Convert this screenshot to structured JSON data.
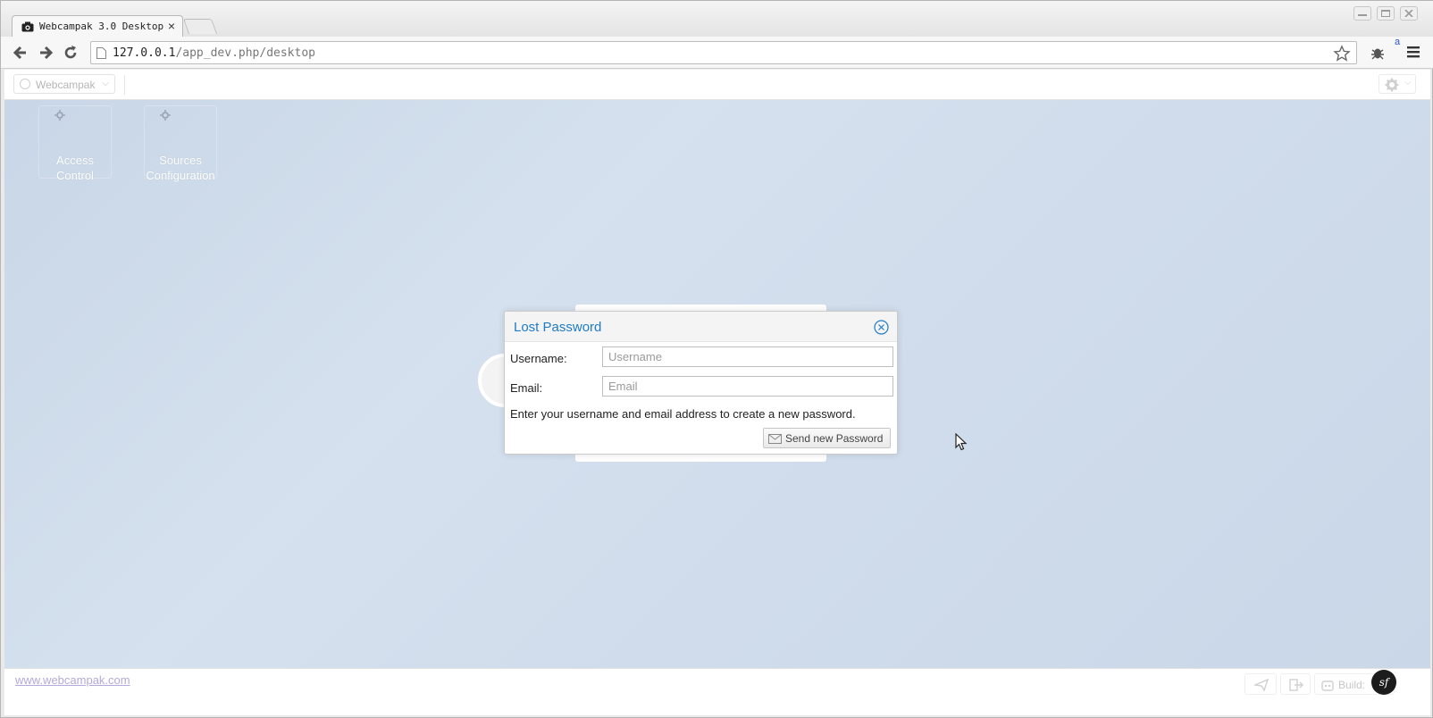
{
  "browser": {
    "tab_title": "Webcampak 3.0 Desktop",
    "tab_close": "×",
    "url_host": "127.0.0.1",
    "url_path": "/app_dev.php/desktop",
    "extension_badge": "a"
  },
  "appbar": {
    "app_name": "Webcampak",
    "app_menu_chevron": "⌵"
  },
  "desktop": {
    "icons": [
      {
        "label_line1": "Access",
        "label_line2": "Control",
        "icon": "gear-icon"
      },
      {
        "label_line1": "Sources",
        "label_line2": "Configuration",
        "icon": "gear-icon"
      }
    ]
  },
  "dialog": {
    "title": "Lost Password",
    "username_label": "Username:",
    "username_placeholder": "Username",
    "email_label": "Email:",
    "email_placeholder": "Email",
    "help_text": "Enter your username and email address to create a new password.",
    "send_button": "Send new Password"
  },
  "footer": {
    "site_link": "www.webcampak.com",
    "build_label": "Build:",
    "symfony_badge": "sf"
  },
  "colors": {
    "dialog_title": "#1e7bc6",
    "desktop_bg": "#cfdbea",
    "link": "#b4a9d8"
  }
}
